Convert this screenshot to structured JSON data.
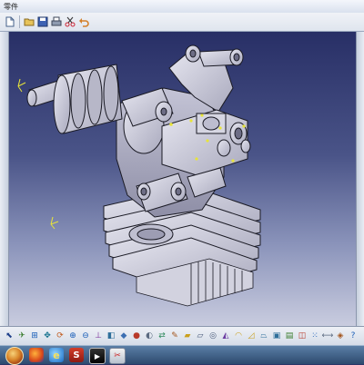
{
  "window": {
    "title": "零件"
  },
  "menubar": {
    "buttons": [
      {
        "icon": "new-file-icon"
      },
      {
        "icon": "open-folder-icon"
      },
      {
        "icon": "save-icon"
      },
      {
        "icon": "print-icon"
      },
      {
        "icon": "cut-icon"
      },
      {
        "icon": "copy-icon"
      },
      {
        "icon": "paste-icon"
      },
      {
        "icon": "undo-icon"
      }
    ]
  },
  "viewport": {
    "background_top": "#282f66",
    "background_bottom": "#c9ccdf",
    "model_color": "#c9c9d8",
    "model_edge_color": "#1a1a24",
    "highlight_color": "#e8e43a"
  },
  "bottom_toolbar": {
    "icons": [
      "select-arrow-icon",
      "fly-mode-icon",
      "fit-all-icon",
      "pan-icon",
      "rotate-icon",
      "zoom-in-icon",
      "zoom-out-icon",
      "normal-view-icon",
      "multi-view-icon",
      "iso-view-icon",
      "shading-icon",
      "hide-show-icon",
      "swap-space-icon",
      "sketch-icon",
      "pad-icon",
      "pocket-icon",
      "hole-icon",
      "shaft-icon",
      "fillet-icon",
      "chamfer-icon",
      "draft-icon",
      "shell-icon",
      "thickness-icon",
      "mirror-icon",
      "pattern-icon",
      "measure-icon",
      "material-icon",
      "analysis-icon",
      "help-icon"
    ]
  },
  "taskbar": {
    "apps": [
      {
        "icon": "start-orb-icon"
      },
      {
        "icon": "firefox-icon"
      },
      {
        "icon": "internet-explorer-icon"
      },
      {
        "icon": "catia-s-icon",
        "label": "S"
      },
      {
        "icon": "media-player-icon"
      },
      {
        "icon": "screenshot-tool-icon"
      }
    ]
  }
}
